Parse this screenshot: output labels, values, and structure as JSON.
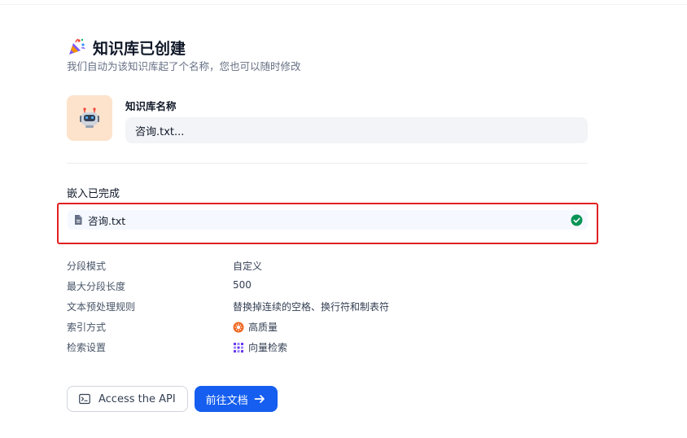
{
  "header": {
    "title": "知识库已创建",
    "subtitle": "我们自动为该知识库起了个名称，您也可以随时修改",
    "icon": "party-popper-icon"
  },
  "dataset_name": {
    "label": "知识库名称",
    "value": "咨询.txt...",
    "avatar_icon": "robot-icon"
  },
  "embedding": {
    "title": "嵌入已完成",
    "files": [
      {
        "name": "咨询.txt",
        "status": "completed",
        "icon": "document-icon"
      }
    ]
  },
  "properties": [
    {
      "key": "分段模式",
      "value": "自定义"
    },
    {
      "key": "最大分段长度",
      "value": "500"
    },
    {
      "key": "文本预处理规则",
      "value": "替换掉连续的空格、换行符和制表符"
    },
    {
      "key": "索引方式",
      "value": "高质量",
      "icon": "high-quality-icon"
    },
    {
      "key": "检索设置",
      "value": "向量检索",
      "icon": "vector-search-icon"
    }
  ],
  "actions": {
    "api_label": "Access the API",
    "docs_label": "前往文档"
  },
  "colors": {
    "primary": "#155eef",
    "success": "#079455",
    "highlight_border": "#e02020",
    "avatar_bg": "#fde3cc"
  }
}
